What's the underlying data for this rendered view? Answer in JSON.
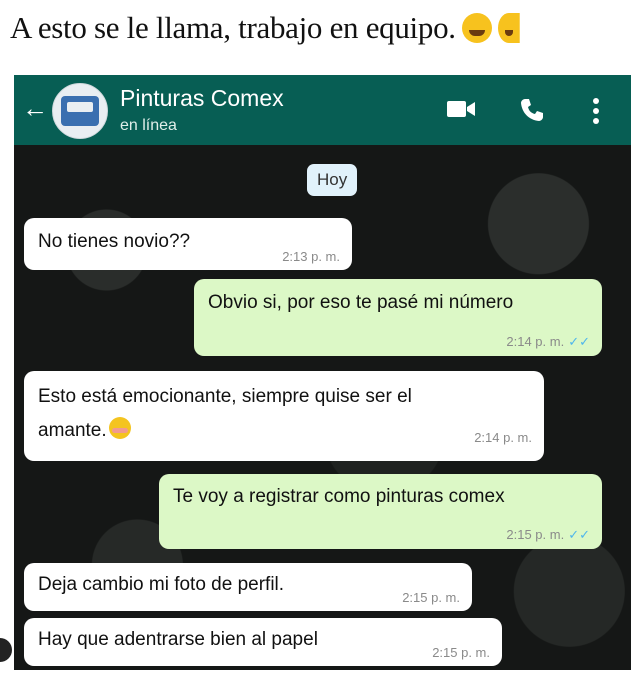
{
  "caption": {
    "text": "A esto se le llama, trabajo en equipo."
  },
  "chat": {
    "contact_name": "Pinturas Comex",
    "contact_status": "en línea",
    "date_label": "Hoy"
  },
  "messages": [
    {
      "direction": "in",
      "text": "No tienes novio??",
      "time": "2:13 p. m."
    },
    {
      "direction": "out",
      "text": "Obvio si, por eso te pasé mi número",
      "time": "2:14 p. m.",
      "ticks": "✓✓"
    },
    {
      "direction": "in",
      "text_line1": "Esto está emocionante, siempre quise ser el",
      "text_line2": "amante.",
      "time": "2:14 p. m."
    },
    {
      "direction": "out",
      "text": "Te voy a registrar como pinturas comex",
      "time": "2:15 p. m.",
      "ticks": "✓✓"
    },
    {
      "direction": "in",
      "text": "Deja cambio mi foto de perfil.",
      "time": "2:15 p. m."
    },
    {
      "direction": "in",
      "text": "Hay que adentrarse bien al papel",
      "time": "2:15 p. m."
    }
  ],
  "icons": {
    "back": "arrow-left-icon",
    "video": "video-camera-icon",
    "call": "phone-icon",
    "menu": "more-vertical-icon"
  },
  "colors": {
    "header": "#075e54",
    "incoming_bubble": "#ffffff",
    "outgoing_bubble": "#dcf8c6",
    "read_ticks": "#4fb6ec"
  }
}
